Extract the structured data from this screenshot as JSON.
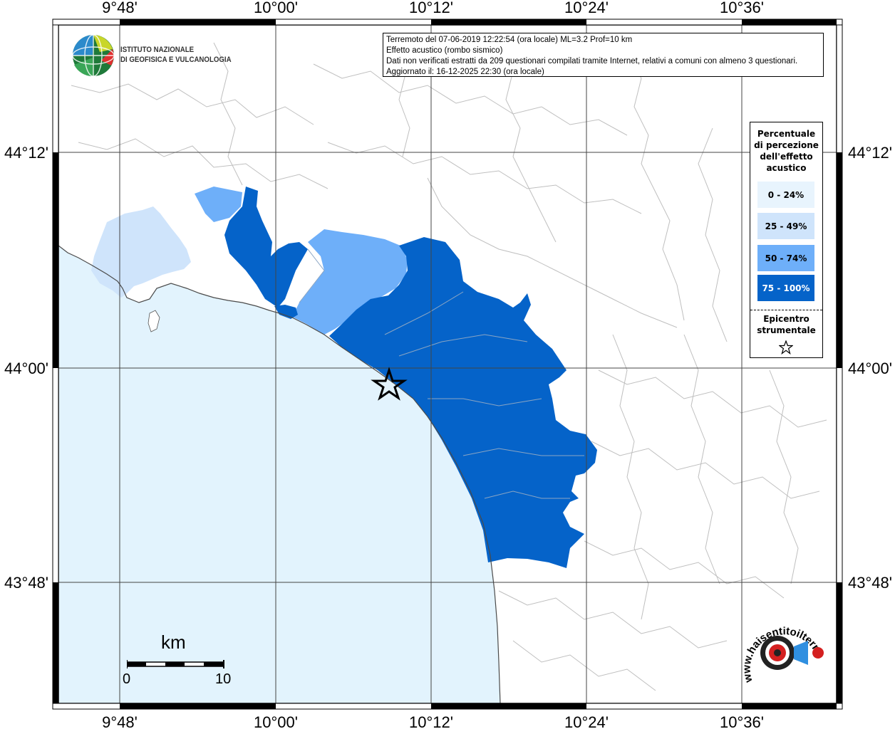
{
  "map": {
    "lon_labels": [
      "9°48'",
      "10°00'",
      "10°12'",
      "10°24'",
      "10°36'"
    ],
    "lat_labels": [
      "44°12'",
      "44°00'",
      "43°48'"
    ],
    "colors": {
      "sea": "#e2f3fd",
      "class_0_24": "#e8f4fd",
      "class_25_49": "#cfe4fb",
      "class_50_74": "#6eaff9",
      "class_75_100": "#0563c9"
    }
  },
  "info": {
    "line1": "Terremoto del 07-06-2019 12:22:54 (ora locale) ML=3.2 Prof=10 km",
    "line2": "Effetto acustico (rombo sismico)",
    "line3": "Dati non verificati estratti da 209 questionari compilati tramite Internet, relativi a comuni con almeno 3 questionari.",
    "line4": "Aggiornato il: 16-12-2025 22:30 (ora locale)"
  },
  "logo": {
    "line1": "ISTITUTO NAZIONALE",
    "line2": "DI GEOFISICA E VULCANOLOGIA"
  },
  "legend": {
    "title_lines": [
      "Percentuale",
      "di percezione",
      "dell'effetto",
      "acustico"
    ],
    "items": [
      {
        "label": "0 - 24%",
        "color": "#e8f4fd",
        "text_color": "#000000"
      },
      {
        "label": "25 - 49%",
        "color": "#cfe4fb",
        "text_color": "#000000"
      },
      {
        "label": "50 - 74%",
        "color": "#6eaff9",
        "text_color": "#000000"
      },
      {
        "label": "75 - 100%",
        "color": "#0563c9",
        "text_color": "#ffffff"
      }
    ],
    "epicenter_lines": [
      "Epicentro",
      "strumentale"
    ],
    "star_icon": "star-icon"
  },
  "scale": {
    "title": "km",
    "min": "0",
    "max": "10"
  },
  "hst": {
    "text": "www.haisentitoilterremoto.it"
  }
}
